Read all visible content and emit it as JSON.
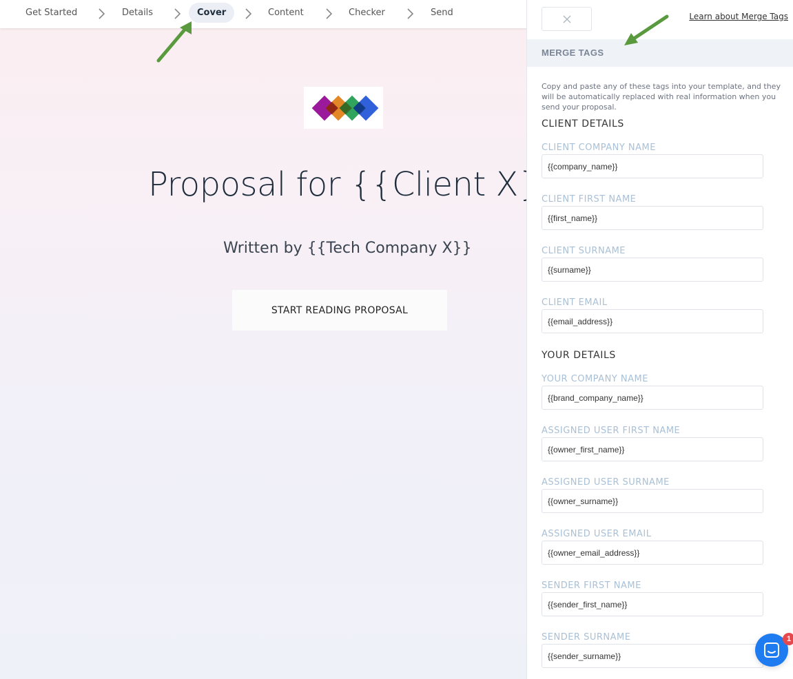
{
  "steps": [
    {
      "label": "Get Started"
    },
    {
      "label": "Details"
    },
    {
      "label": "Cover",
      "active": true
    },
    {
      "label": "Content"
    },
    {
      "label": "Checker"
    },
    {
      "label": "Send"
    }
  ],
  "cover": {
    "title": "Proposal for {{Client X}}",
    "subtitle": "Written by {{Tech Company X}}",
    "button_label": "START READING PROPOSAL"
  },
  "panel": {
    "close_icon": "close-icon",
    "learn_link": "Learn about Merge Tags",
    "header": "MERGE TAGS",
    "intro": "Copy and paste any of these tags into your template, and they will be automatically replaced with real information when you send your proposal.",
    "client_section": "CLIENT DETAILS",
    "your_section": "YOUR DETAILS",
    "client_fields": [
      {
        "label": "CLIENT COMPANY NAME",
        "value": "{{company_name}}"
      },
      {
        "label": "CLIENT FIRST NAME",
        "value": "{{first_name}}"
      },
      {
        "label": "CLIENT SURNAME",
        "value": "{{surname}}"
      },
      {
        "label": "CLIENT EMAIL",
        "value": "{{email_address}}"
      }
    ],
    "your_fields": [
      {
        "label": "YOUR COMPANY NAME",
        "value": "{{brand_company_name}}"
      },
      {
        "label": "ASSIGNED USER FIRST NAME",
        "value": "{{owner_first_name}}"
      },
      {
        "label": "ASSIGNED USER SURNAME",
        "value": "{{owner_surname}}"
      },
      {
        "label": "ASSIGNED USER EMAIL",
        "value": "{{owner_email_address}}"
      },
      {
        "label": "SENDER FIRST NAME",
        "value": "{{sender_first_name}}"
      },
      {
        "label": "SENDER SURNAME",
        "value": "{{sender_surname}}"
      }
    ]
  },
  "chat": {
    "badge": "1"
  },
  "colors": {
    "accent_arrow": "#5a9a3e",
    "label_blue": "#a9c0d6",
    "chat_blue": "#1f7cf0",
    "badge_red": "#e5484d"
  }
}
